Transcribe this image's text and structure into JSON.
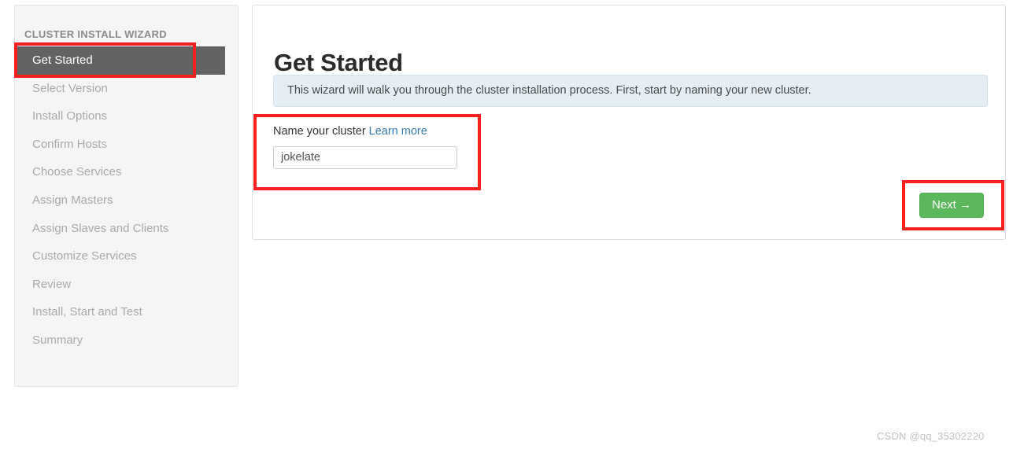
{
  "sidebar": {
    "title": "CLUSTER INSTALL WIZARD",
    "items": [
      {
        "label": "Get Started",
        "active": true
      },
      {
        "label": "Select Version",
        "active": false
      },
      {
        "label": "Install Options",
        "active": false
      },
      {
        "label": "Confirm Hosts",
        "active": false
      },
      {
        "label": "Choose Services",
        "active": false
      },
      {
        "label": "Assign Masters",
        "active": false
      },
      {
        "label": "Assign Slaves and Clients",
        "active": false
      },
      {
        "label": "Customize Services",
        "active": false
      },
      {
        "label": "Review",
        "active": false
      },
      {
        "label": "Install, Start and Test",
        "active": false
      },
      {
        "label": "Summary",
        "active": false
      }
    ]
  },
  "main": {
    "page_title": "Get Started",
    "alert_text": "This wizard will walk you through the cluster installation process. First, start by naming your new cluster.",
    "form": {
      "label": "Name your cluster",
      "learn_more_label": "Learn more",
      "cluster_name_value": "jokelate",
      "cluster_name_placeholder": ""
    },
    "next_button_label": "Next →"
  },
  "annotations": [
    {
      "name": "nav-get-started-highlight"
    },
    {
      "name": "cluster-name-form-highlight"
    },
    {
      "name": "next-button-highlight"
    }
  ],
  "watermark": "CSDN @qq_35302220",
  "colors": {
    "active_nav_bg": "#636363",
    "alert_bg": "#e4eef4",
    "link": "#337ab7",
    "next_button": "#5cb85c",
    "annotation": "#f91f1f"
  }
}
